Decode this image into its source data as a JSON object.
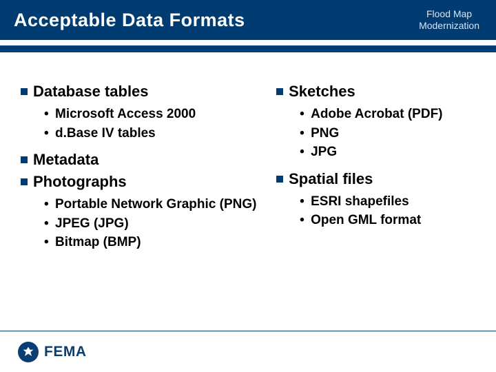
{
  "header": {
    "title": "Acceptable Data Formats",
    "subtitle_line1": "Flood Map",
    "subtitle_line2": "Modernization"
  },
  "left": {
    "sec1": "Database tables",
    "sec1_items": {
      "a": "Microsoft Access 2000",
      "b": "d.Base IV tables"
    },
    "sec2": "Metadata",
    "sec3": "Photographs",
    "sec3_items": {
      "a": "Portable Network Graphic (PNG)",
      "b": "JPEG (JPG)",
      "c": "Bitmap (BMP)"
    }
  },
  "right": {
    "sec1": "Sketches",
    "sec1_items": {
      "a": "Adobe Acrobat (PDF)",
      "b": "PNG",
      "c": "JPG"
    },
    "sec2": "Spatial files",
    "sec2_items": {
      "a": "ESRI shapefiles",
      "b": "Open GML format"
    }
  },
  "footer": {
    "agency": "FEMA"
  }
}
